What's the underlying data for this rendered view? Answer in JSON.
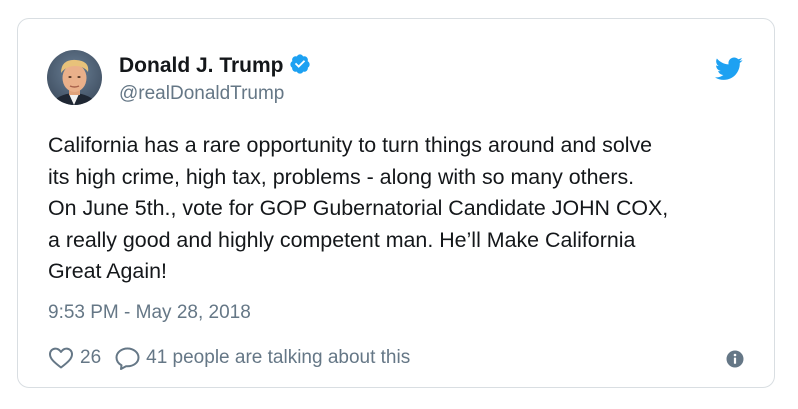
{
  "author": {
    "display_name": "Donald J. Trump",
    "handle": "@realDonaldTrump",
    "verified": true
  },
  "tweet": {
    "text": "California has a rare opportunity to turn things around and solve\nits high crime, high tax, problems - along with so many others.\nOn June 5th., vote for GOP Gubernatorial Candidate JOHN COX,\na really good and highly competent man. He’ll Make California\nGreat Again!",
    "timestamp": "9:53 PM - May 28, 2018"
  },
  "actions": {
    "like_count": "26",
    "reply_text": "41 people are talking about this"
  },
  "icons": {
    "verified": "verified-badge-icon",
    "brand": "twitter-bird-icon",
    "like": "heart-outline-icon",
    "reply": "speech-bubble-icon",
    "info": "info-circle-icon"
  },
  "colors": {
    "brand_blue": "#1da1f2",
    "text_primary": "#14171a",
    "text_secondary": "#657786",
    "card_border": "#d9dee2"
  }
}
